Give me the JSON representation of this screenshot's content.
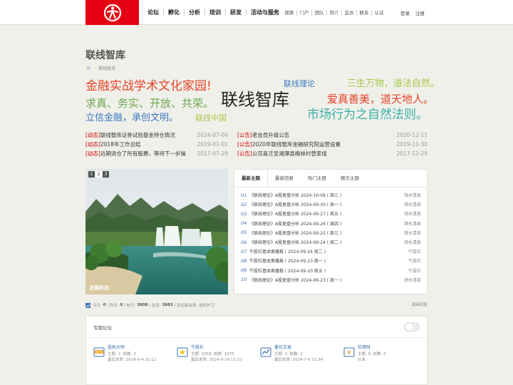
{
  "topbar": {
    "nav": [
      "论坛",
      "孵化",
      "分析",
      "培训",
      "研发",
      "活动与服务"
    ],
    "subnav": [
      "搜索",
      "门户",
      "团队",
      "简介",
      "会员",
      "联系",
      "认证"
    ],
    "login": "登录",
    "register": "注册"
  },
  "page": {
    "title": "联线智库",
    "breadcrumb": "联线智库"
  },
  "banner": {
    "line1": "金融实战学术文化家园!",
    "line2": "求真、务实、开放、共荣。",
    "line3": "立信金融，承创文明。",
    "center": "联线智库",
    "top_mid": "联线理论",
    "bottom_mid": "联线中国",
    "right1": "三生万物，道法自然。",
    "right2": "爱真善美，道天地人。",
    "right3": "市场行为之自然法则。"
  },
  "notices": {
    "left": [
      {
        "tag": "[动态]",
        "title": "联线智库证券试验基金持仓情况",
        "date": "2024-07-04"
      },
      {
        "tag": "[动态]",
        "title": "2018年工作总结",
        "date": "2019-01-01"
      },
      {
        "tag": "[动态]",
        "title": "近期清仓了所有股票，等待下一步操",
        "date": "2017-07-29"
      }
    ],
    "right": [
      {
        "tag": "[公告]",
        "title": "老会员升级公告",
        "date": "2020-12-11"
      },
      {
        "tag": "[公告]",
        "title": "2020年联线智库金融研究院运营设置",
        "date": "2019-11-30"
      },
      {
        "tag": "[公告]",
        "title": "公司喜迁至湘潭县梅林村曾家组",
        "date": "2017-12-29"
      }
    ]
  },
  "slide": {
    "pages": [
      "1",
      "2",
      "3"
    ],
    "caption": "发展形态"
  },
  "tabs": [
    "最新主题",
    "最新回复",
    "热门主题",
    "精华主题"
  ],
  "threads": [
    {
      "n": "01",
      "title": "《联线理论》A股复盘分析 2024-10-09 ( 周三 )",
      "author": "濒水清泉"
    },
    {
      "n": "02",
      "title": "《联线理论》A股复盘分析 2024-09-30 ( 周一 )",
      "author": "濒水清泉"
    },
    {
      "n": "03",
      "title": "《联线理论》A股复盘分析 2024-09-27 ( 周五 )",
      "author": "濒水清泉"
    },
    {
      "n": "04",
      "title": "《联线理论》A股复盘分析 2024-09-26 ( 周四 )",
      "author": "濒水清泉"
    },
    {
      "n": "05",
      "title": "《联线理论》A股复盘分析 2024-09-25 ( 周三 )",
      "author": "濒水清泉"
    },
    {
      "n": "06",
      "title": "《联线理论》A股复盘分析 2024-09-24 ( 周二 )",
      "author": "濒水清泉"
    },
    {
      "n": "07",
      "title": "牛股栏基本面播报 ( 2024-09-24 周二 )",
      "author": "牛股栏"
    },
    {
      "n": "08",
      "title": "牛股栏基本面播报 ( 2024-09-23 周一 )",
      "author": "牛股栏"
    },
    {
      "n": "09",
      "title": "牛股栏基本面播报 ( 2024-09-20 周五 )",
      "author": "牛股栏"
    },
    {
      "n": "10",
      "title": "《联线理论》A股复盘分析 2024-09-23 ( 周一 )",
      "author": "濒水清泉"
    }
  ],
  "stats": {
    "today_label": "今日:",
    "today": "0",
    "yesterday_label": "昨日:",
    "yesterday": "0",
    "posts_label": "帖子:",
    "posts": "3808",
    "members_label": "会员:",
    "members": "3883",
    "welcome": "欢迎新会员: 金树护卫",
    "latest_reply": "最新回复"
  },
  "forum": {
    "section_title": "专题论坛",
    "boards": [
      {
        "name": "投机大师",
        "line1": "主题: 2, 帖数: 3",
        "line2": "最后发表: 2024-9-4 20:12",
        "icon": "new-badge-icon"
      },
      {
        "name": "牛股栏",
        "line1": "主题: 1059, 帖数: 1075",
        "line2": "最后发表: 2024-9-24 15:22",
        "icon": "star-badge-icon"
      },
      {
        "name": "量化交易",
        "line1": "主题: 2, 帖数: 2",
        "line2": "最后发表: 2024-7-6 11:34",
        "icon": "chart-board-icon"
      },
      {
        "name": "恰理财",
        "line1": "主题: 0, 帖数: 0",
        "line2": "从未",
        "icon": "money-icon"
      }
    ]
  },
  "colors": {
    "brand_red": "#e60012",
    "link_blue": "#3a6fb0",
    "notice_red": "#cc0000"
  }
}
